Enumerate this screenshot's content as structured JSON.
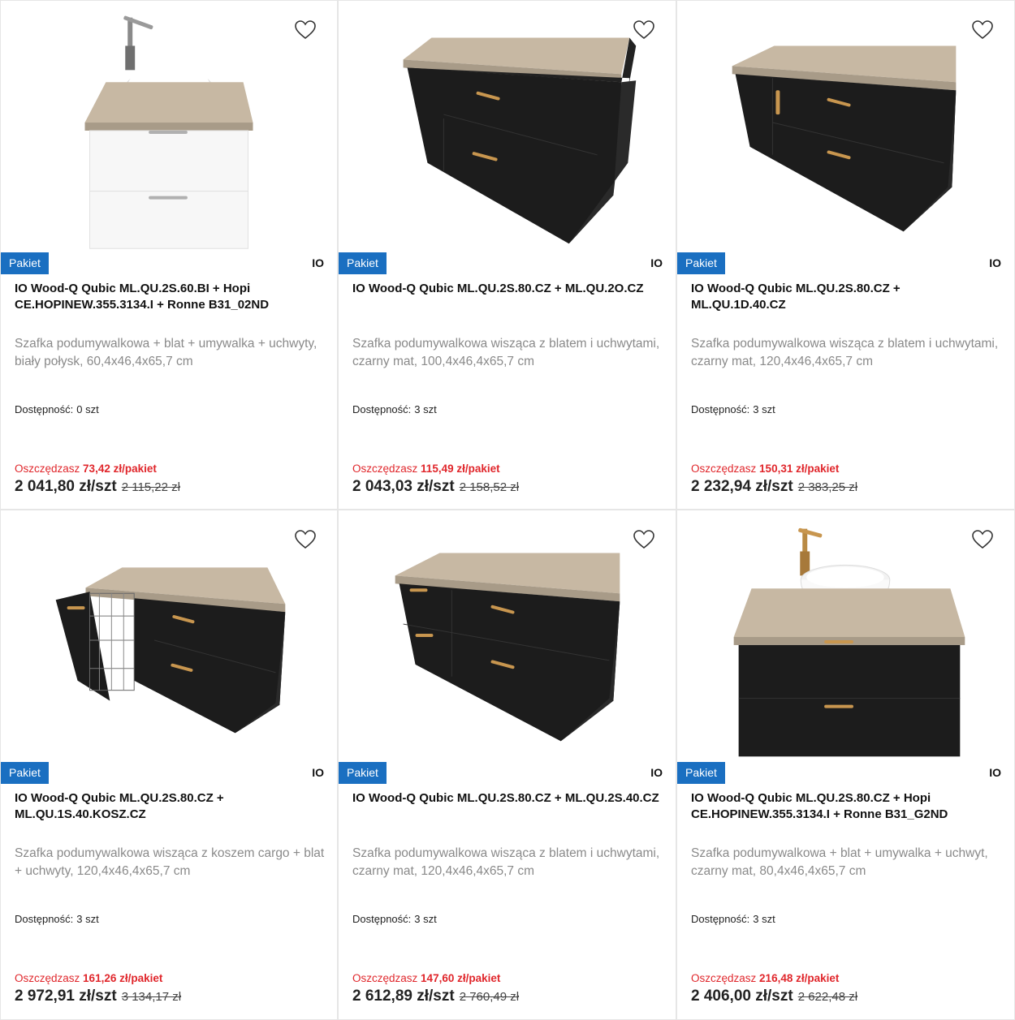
{
  "products": [
    {
      "badge": "Pakiet",
      "brand": "IO",
      "title": "IO Wood-Q Qubic ML.QU.2S.60.BI + Hopi CE.HOPINEW.355.3134.I + Ronne B31_02ND",
      "description": "Szafka podumywalkowa + blat + umywalka + uchwyty, biały połysk, 60,4x46,4x65,7 cm",
      "availability_label": "Dostępność:",
      "availability_value": "0 szt",
      "save_label": "Oszczędzasz",
      "save_value": "73,42 zł/pakiet",
      "price": "2 041,80 zł/szt",
      "old_price": "2 115,22 zł",
      "image": "white-cabinet-with-basin-and-silver-tap"
    },
    {
      "badge": "Pakiet",
      "brand": "IO",
      "title": "IO Wood-Q Qubic ML.QU.2S.80.CZ + ML.QU.2O.CZ",
      "description": "Szafka podumywalkowa wisząca z blatem i uchwytami, czarny mat, 100,4x46,4x65,7 cm",
      "availability_label": "Dostępność:",
      "availability_value": "3 szt",
      "save_label": "Oszczędzasz",
      "save_value": "115,49 zł/pakiet",
      "price": "2 043,03 zł/szt",
      "old_price": "2 158,52 zł",
      "image": "black-cabinet-with-open-shelf"
    },
    {
      "badge": "Pakiet",
      "brand": "IO",
      "title": "IO Wood-Q Qubic ML.QU.2S.80.CZ + ML.QU.1D.40.CZ",
      "description": "Szafka podumywalkowa wisząca z blatem i uchwytami, czarny mat, 120,4x46,4x65,7 cm",
      "availability_label": "Dostępność:",
      "availability_value": "3 szt",
      "save_label": "Oszczędzasz",
      "save_value": "150,31 zł/pakiet",
      "price": "2 232,94 zł/szt",
      "old_price": "2 383,25 zł",
      "image": "black-cabinet-with-door"
    },
    {
      "badge": "Pakiet",
      "brand": "IO",
      "title": "IO Wood-Q Qubic ML.QU.2S.80.CZ + ML.QU.1S.40.KOSZ.CZ",
      "description": "Szafka podumywalkowa wisząca z koszem cargo + blat + uchwyty, 120,4x46,4x65,7 cm",
      "availability_label": "Dostępność:",
      "availability_value": "3 szt",
      "save_label": "Oszczędzasz",
      "save_value": "161,26 zł/pakiet",
      "price": "2 972,91 zł/szt",
      "old_price": "3 134,17 zł",
      "image": "black-cabinet-with-cargo-basket"
    },
    {
      "badge": "Pakiet",
      "brand": "IO",
      "title": "IO Wood-Q Qubic ML.QU.2S.80.CZ + ML.QU.2S.40.CZ",
      "description": "Szafka podumywalkowa wisząca z blatem i uchwytami, czarny mat, 120,4x46,4x65,7 cm",
      "availability_label": "Dostępność:",
      "availability_value": "3 szt",
      "save_label": "Oszczędzasz",
      "save_value": "147,60 zł/pakiet",
      "price": "2 612,89 zł/szt",
      "old_price": "2 760,49 zł",
      "image": "black-cabinet-four-drawers"
    },
    {
      "badge": "Pakiet",
      "brand": "IO",
      "title": "IO Wood-Q Qubic ML.QU.2S.80.CZ + Hopi CE.HOPINEW.355.3134.I + Ronne B31_G2ND",
      "description": "Szafka podumywalkowa + blat + umywalka + uchwyt, czarny mat, 80,4x46,4x65,7 cm",
      "availability_label": "Dostępność:",
      "availability_value": "3 szt",
      "save_label": "Oszczędzasz",
      "save_value": "216,48 zł/pakiet",
      "price": "2 406,00 zł/szt",
      "old_price": "2 622,48 zł",
      "image": "black-cabinet-with-basin-and-gold-tap"
    }
  ],
  "icons": {
    "favorite": "heart-outline-icon"
  },
  "colors": {
    "badge": "#1a6fc1",
    "saving": "#e0262b",
    "wood": "#c7b8a3",
    "black_cabinet": "#1c1c1c",
    "white_cabinet": "#f7f7f7",
    "handle_gold": "#c8964f"
  }
}
